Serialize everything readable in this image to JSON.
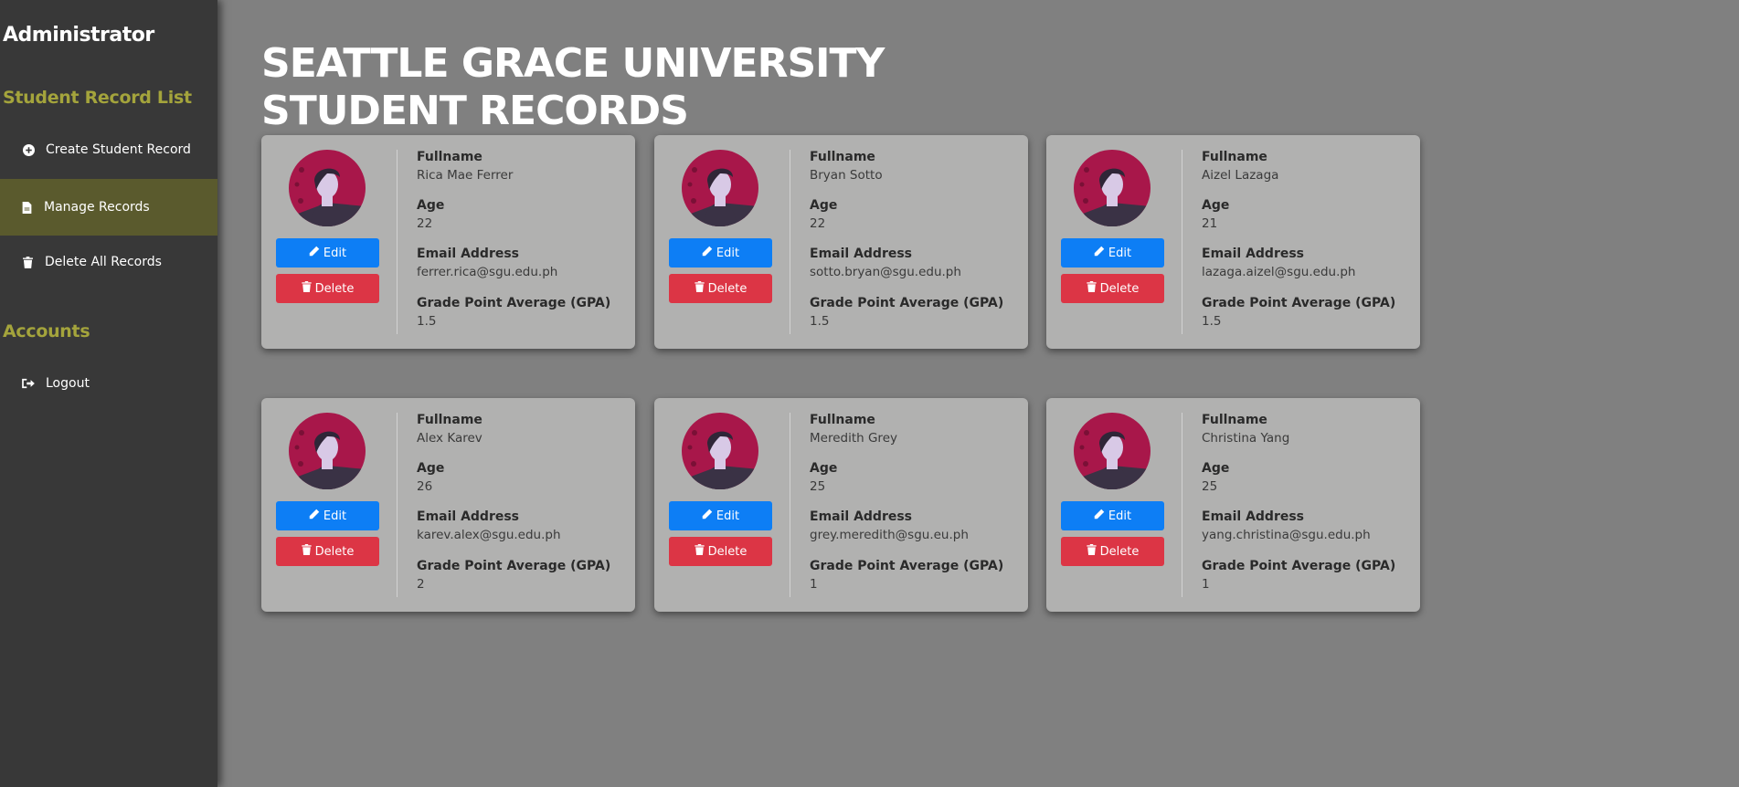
{
  "sidebar": {
    "brand": "Administrator",
    "section_records": "Student Record List",
    "items": [
      {
        "label": "Create Student Record",
        "icon": "plus-circle-icon"
      },
      {
        "label": "Manage Records",
        "icon": "file-icon",
        "active": true
      },
      {
        "label": "Delete All Records",
        "icon": "trash-icon"
      }
    ],
    "section_accounts": "Accounts",
    "logout": {
      "label": "Logout",
      "icon": "sign-out-icon"
    }
  },
  "page": {
    "title_line1": "SEATTLE GRACE UNIVERSITY",
    "title_line2": "STUDENT RECORDS"
  },
  "labels": {
    "fullname": "Fullname",
    "age": "Age",
    "email": "Email Address",
    "gpa": "Grade Point Average (GPA)",
    "edit": "Edit",
    "delete": "Delete"
  },
  "colors": {
    "sidebar_bg": "#383838",
    "accent_olive": "#a4a43c",
    "edit_blue": "#0d7ef5",
    "delete_red": "#dc3545",
    "avatar_bg": "#a8174a"
  },
  "students": [
    {
      "fullname": "Rica Mae Ferrer",
      "age": "22",
      "email": "ferrer.rica@sgu.edu.ph",
      "gpa": "1.5"
    },
    {
      "fullname": "Bryan Sotto",
      "age": "22",
      "email": "sotto.bryan@sgu.edu.ph",
      "gpa": "1.5"
    },
    {
      "fullname": "Aizel Lazaga",
      "age": "21",
      "email": "lazaga.aizel@sgu.edu.ph",
      "gpa": "1.5"
    },
    {
      "fullname": "Alex Karev",
      "age": "26",
      "email": "karev.alex@sgu.edu.ph",
      "gpa": "2"
    },
    {
      "fullname": "Meredith Grey",
      "age": "25",
      "email": "grey.meredith@sgu.eu.ph",
      "gpa": "1"
    },
    {
      "fullname": "Christina Yang",
      "age": "25",
      "email": "yang.christina@sgu.edu.ph",
      "gpa": "1"
    }
  ]
}
